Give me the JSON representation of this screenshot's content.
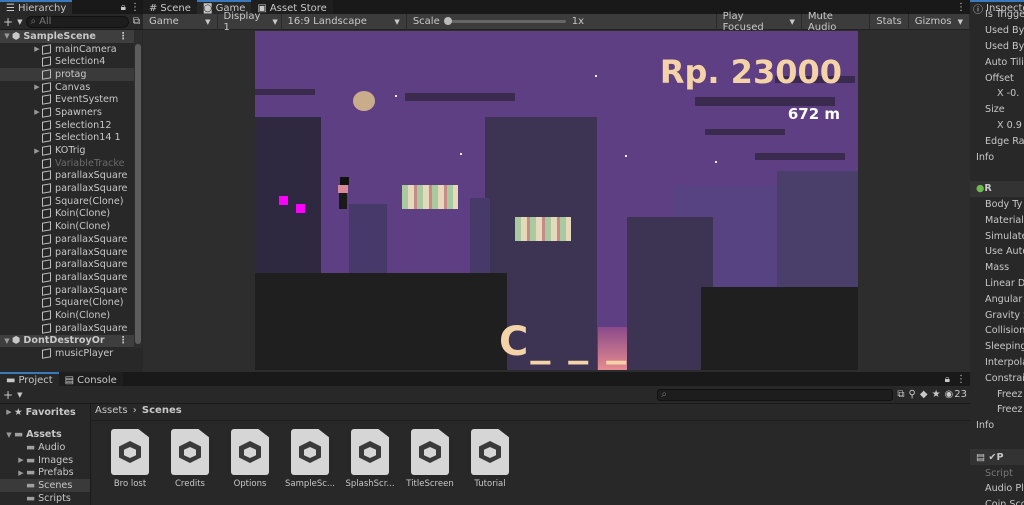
{
  "hierarchy": {
    "tab": "Hierarchy",
    "search_placeholder": "All",
    "items": [
      {
        "label": "SampleScene",
        "indent": 0,
        "arrow": "▼",
        "scene": true
      },
      {
        "label": "mainCamera",
        "indent": 1,
        "arrow": "▶"
      },
      {
        "label": "Selection4",
        "indent": 1,
        "arrow": ""
      },
      {
        "label": "protag",
        "indent": 1,
        "arrow": "",
        "sel": true
      },
      {
        "label": "Canvas",
        "indent": 1,
        "arrow": "▶"
      },
      {
        "label": "EventSystem",
        "indent": 1,
        "arrow": ""
      },
      {
        "label": "Spawners",
        "indent": 1,
        "arrow": "▶"
      },
      {
        "label": "Selection12",
        "indent": 1,
        "arrow": ""
      },
      {
        "label": "Selection14 1",
        "indent": 1,
        "arrow": ""
      },
      {
        "label": "KOTrig",
        "indent": 1,
        "arrow": "▶"
      },
      {
        "label": "VariableTracke",
        "indent": 1,
        "arrow": "",
        "dim": true
      },
      {
        "label": "parallaxSquare",
        "indent": 1,
        "arrow": ""
      },
      {
        "label": "parallaxSquare",
        "indent": 1,
        "arrow": ""
      },
      {
        "label": "Square(Clone)",
        "indent": 1,
        "arrow": ""
      },
      {
        "label": "Koin(Clone)",
        "indent": 1,
        "arrow": ""
      },
      {
        "label": "Koin(Clone)",
        "indent": 1,
        "arrow": ""
      },
      {
        "label": "parallaxSquare",
        "indent": 1,
        "arrow": ""
      },
      {
        "label": "parallaxSquare",
        "indent": 1,
        "arrow": ""
      },
      {
        "label": "parallaxSquare",
        "indent": 1,
        "arrow": ""
      },
      {
        "label": "parallaxSquare",
        "indent": 1,
        "arrow": ""
      },
      {
        "label": "parallaxSquare",
        "indent": 1,
        "arrow": ""
      },
      {
        "label": "Square(Clone)",
        "indent": 1,
        "arrow": ""
      },
      {
        "label": "Koin(Clone)",
        "indent": 1,
        "arrow": ""
      },
      {
        "label": "parallaxSquare",
        "indent": 1,
        "arrow": ""
      },
      {
        "label": "DontDestroyOr",
        "indent": 0,
        "arrow": "▼",
        "scene": true
      },
      {
        "label": "musicPlayer",
        "indent": 1,
        "arrow": ""
      }
    ]
  },
  "center_tabs": {
    "scene": "Scene",
    "game": "Game",
    "asset_store": "Asset Store"
  },
  "game_toolbar": {
    "mode": "Game",
    "display": "Display 1",
    "aspect": "16:9 Landscape",
    "scale_label": "Scale",
    "scale_value": "1x",
    "play_focused": "Play Focused",
    "mute": "Mute Audio",
    "stats": "Stats",
    "gizmos": "Gizmos"
  },
  "game": {
    "money": "Rp. 23000",
    "distance": "672 m",
    "letter": "C_ _ _"
  },
  "inspector": {
    "tab": "Inspecto",
    "rows": [
      "Is Trigge",
      "Used By",
      "Used By",
      "Auto Tilin",
      "Offset",
      "X  -0.",
      "Size",
      "X  0.9",
      "Edge Rad",
      "Info",
      "",
      "R",
      "Body Ty",
      "Material",
      "Simulate",
      "Use Auto",
      "Mass",
      "Linear D",
      "Angular",
      "Gravity S",
      "Collision",
      "Sleeping",
      "Interpola",
      "Constrai",
      "Freez",
      "Freez",
      "Info",
      "",
      "P",
      "Script",
      "Audio Pla",
      "Coin Sco"
    ]
  },
  "project": {
    "tab_project": "Project",
    "tab_console": "Console",
    "favorites": "Favorites",
    "assets": "Assets",
    "folders": [
      "Audio",
      "Images",
      "Prefabs",
      "Scenes",
      "Scripts"
    ],
    "breadcrumb_root": "Assets",
    "breadcrumb_current": "Scenes",
    "hidden_count": "23",
    "files": [
      "Bro lost",
      "Credits",
      "Options",
      "SampleSc...",
      "SplashScr...",
      "TitleScreen",
      "Tutorial"
    ]
  },
  "colors": {
    "accent": "#3a79bb",
    "sky": "#5e3f83",
    "text_cream": "#f5d3a8"
  }
}
